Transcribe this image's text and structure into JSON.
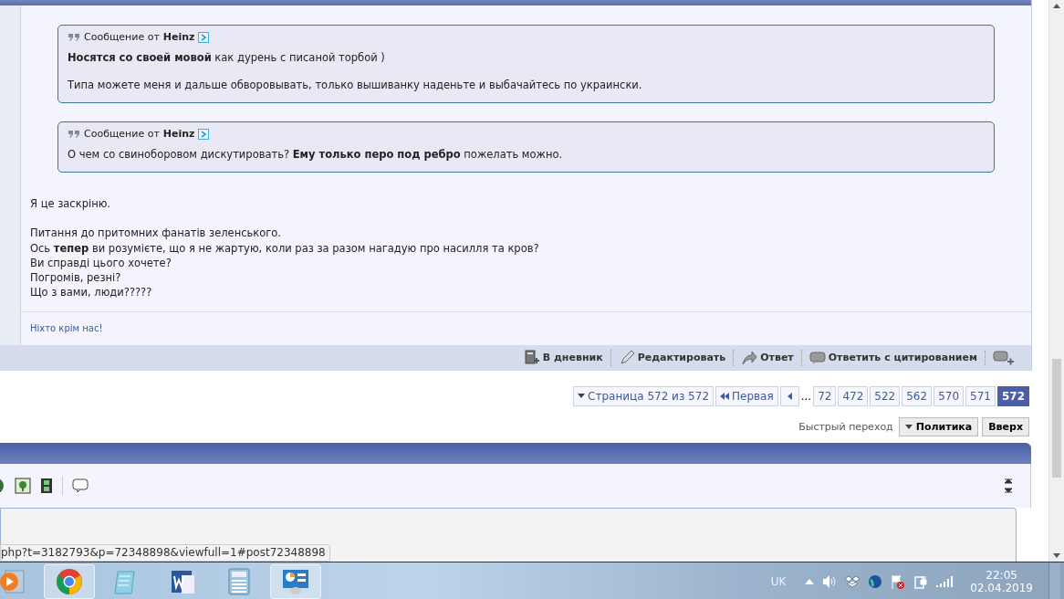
{
  "post": {
    "quotes": [
      {
        "label": "Сообщение от",
        "author": "Heinz",
        "paragraphs": [
          "**Носятся со своей мовой** как дурень с писаной торбой )",
          "Типа можете меня и дальше обворовывать, только вышиванку наденьте и выбачайтесь по украински."
        ]
      },
      {
        "label": "Сообщение от",
        "author": "Heinz",
        "paragraphs": [
          "О чем со свиноборовом дискутировать? **Ему только перо под ребро** пожелать можно."
        ]
      }
    ],
    "body": [
      [
        "Я це заскріню."
      ],
      [
        "Питання до притомних фанатів зеленського.",
        "Ось **тепер** ви розумієте, що я не жартую, коли раз за разом нагадую про насилля та кров?",
        "Ви справді цього хочете?",
        "Погромів, резні?",
        "Що з вами, люди?????"
      ]
    ],
    "signature": "Ніхто крім нас!",
    "actions": [
      {
        "kind": "diary",
        "label": "В дневник"
      },
      {
        "kind": "edit",
        "label": "Редактировать"
      },
      {
        "kind": "reply",
        "label": "Ответ"
      },
      {
        "kind": "quote",
        "label": "Ответить с цитированием"
      },
      {
        "kind": "multiquote"
      }
    ]
  },
  "pagination": {
    "label": "Страница 572 из 572",
    "first": "Первая",
    "ellipsis": "...",
    "pages": [
      {
        "label": "72",
        "selected": false
      },
      {
        "label": "472",
        "selected": false
      },
      {
        "label": "522",
        "selected": false
      },
      {
        "label": "562",
        "selected": false
      },
      {
        "label": "570",
        "selected": false
      },
      {
        "label": "571",
        "selected": false
      },
      {
        "label": "572",
        "selected": true
      }
    ]
  },
  "quick_nav": {
    "label": "Быстрый переход",
    "forum": "Политика",
    "top": "Вверх"
  },
  "status_url": "php?t=3182793&p=72348898&viewfull=1#post72348898",
  "taskbar": {
    "apps": [
      {
        "kind": "media",
        "selected": false
      },
      {
        "kind": "chrome",
        "selected": true
      },
      {
        "kind": "notepad",
        "selected": false
      },
      {
        "kind": "word",
        "selected": false
      },
      {
        "kind": "calculator",
        "selected": false
      },
      {
        "kind": "control-panel",
        "selected": true
      }
    ],
    "language": "UK",
    "time": "22:05",
    "date": "02.04.2019"
  }
}
